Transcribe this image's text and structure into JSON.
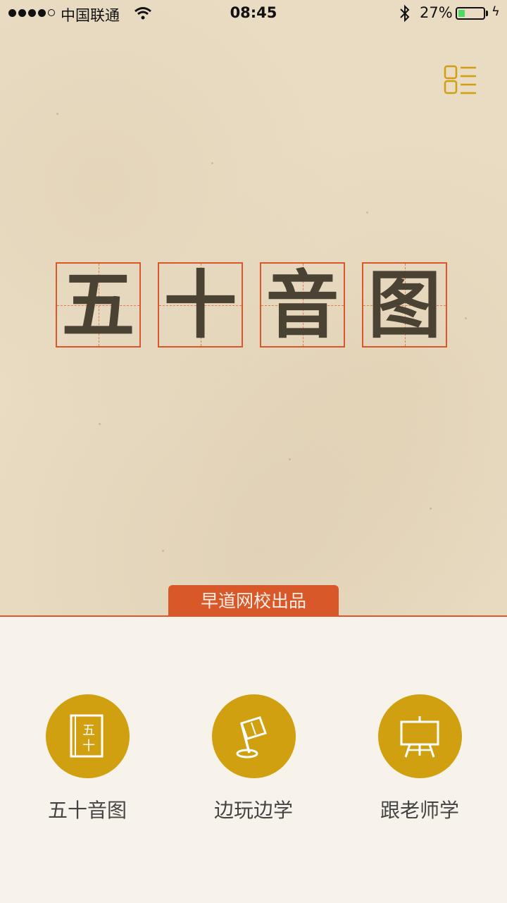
{
  "status_bar": {
    "carrier": "中国联通",
    "time": "08:45",
    "battery": "27%",
    "battery_level": 0.27
  },
  "hero": {
    "title_chars": [
      "五",
      "十",
      "音",
      "图"
    ],
    "publisher": "早道网校出品"
  },
  "nav": [
    {
      "label": "五十音图",
      "icon": "book-icon",
      "icon_text_top": "五",
      "icon_text_bottom": "十"
    },
    {
      "label": "边玩边学",
      "icon": "flag-icon"
    },
    {
      "label": "跟老师学",
      "icon": "easel-icon"
    }
  ],
  "colors": {
    "accent": "#d9582a",
    "gold": "#d1a010",
    "paper": "#e9dcc3",
    "title_text": "#4a4232"
  }
}
